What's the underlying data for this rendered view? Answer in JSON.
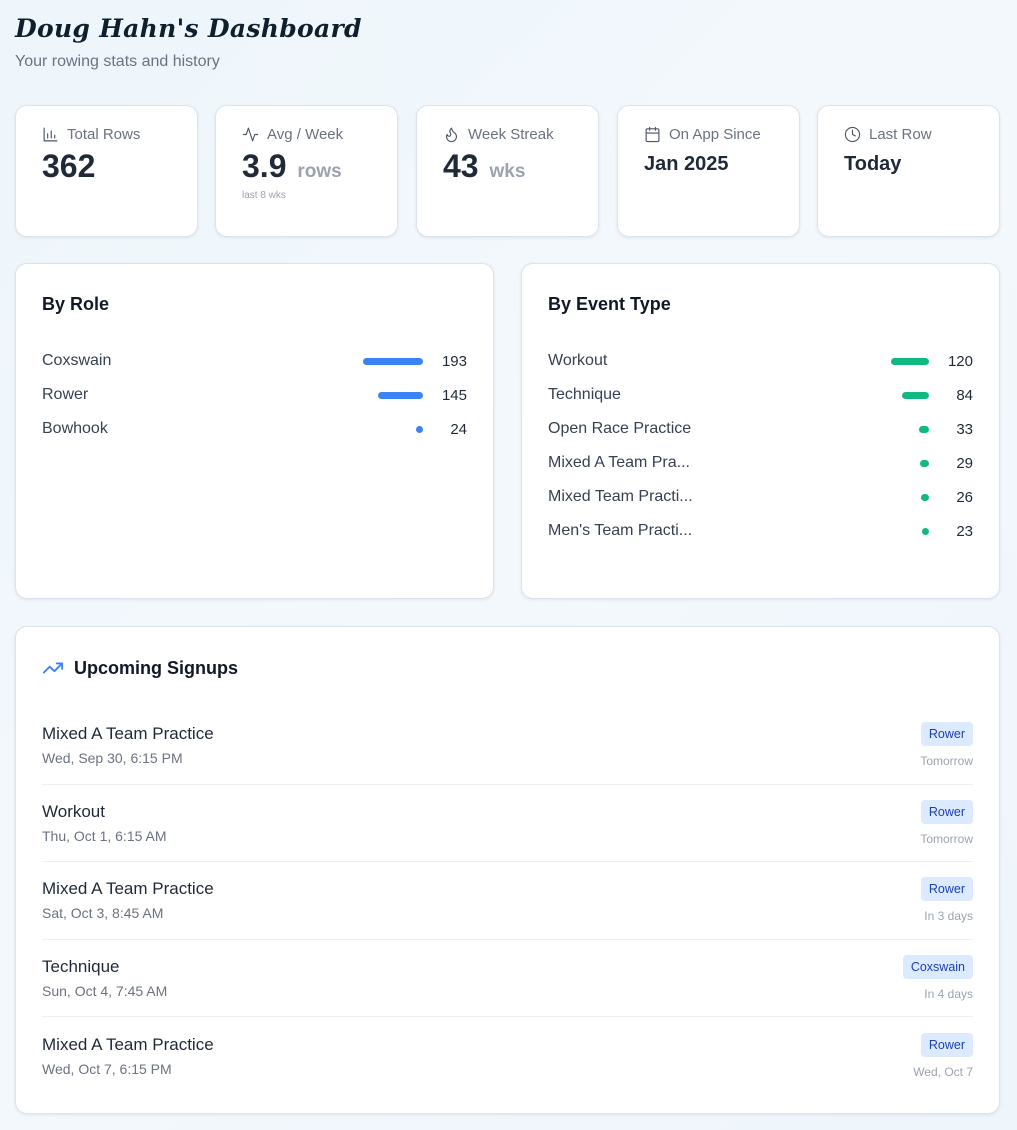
{
  "header": {
    "title": "Doug Hahn's Dashboard",
    "subtitle": "Your rowing stats and history"
  },
  "stats": [
    {
      "label": "Total Rows",
      "value": "362",
      "unit": "",
      "note": "",
      "icon": "bar-chart-icon"
    },
    {
      "label": "Avg / Week",
      "value": "3.9",
      "unit": "rows",
      "note": "last 8 wks",
      "icon": "activity-icon"
    },
    {
      "label": "Week Streak",
      "value": "43",
      "unit": "wks",
      "note": "",
      "icon": "flame-icon"
    },
    {
      "label": "On App Since",
      "value": "Jan 2025",
      "unit": "",
      "note": "",
      "icon": "calendar-icon"
    },
    {
      "label": "Last Row",
      "value": "Today",
      "unit": "",
      "note": "",
      "icon": "clock-icon"
    }
  ],
  "by_role": {
    "title": "By Role",
    "color": "#3b82f6",
    "items": [
      {
        "label": "Coxswain",
        "count": 193
      },
      {
        "label": "Rower",
        "count": 145
      },
      {
        "label": "Bowhook",
        "count": 24
      }
    ]
  },
  "by_event_type": {
    "title": "By Event Type",
    "color": "#10b981",
    "items": [
      {
        "label": "Workout",
        "count": 120
      },
      {
        "label": "Technique",
        "count": 84
      },
      {
        "label": "Open Race Practice",
        "count": 33
      },
      {
        "label": "Mixed A Team Pra...",
        "count": 29
      },
      {
        "label": "Mixed Team Practi...",
        "count": 26
      },
      {
        "label": "Men's Team Practi...",
        "count": 23
      }
    ]
  },
  "upcoming": {
    "title": "Upcoming Signups",
    "icon": "trending-up-icon",
    "items": [
      {
        "name": "Mixed A Team Practice",
        "time": "Wed, Sep 30, 6:15 PM",
        "role": "Rower",
        "when": "Tomorrow"
      },
      {
        "name": "Workout",
        "time": "Thu, Oct 1, 6:15 AM",
        "role": "Rower",
        "when": "Tomorrow"
      },
      {
        "name": "Mixed A Team Practice",
        "time": "Sat, Oct 3, 8:45 AM",
        "role": "Rower",
        "when": "In 3 days"
      },
      {
        "name": "Technique",
        "time": "Sun, Oct 4, 7:45 AM",
        "role": "Coxswain",
        "when": "In 4 days"
      },
      {
        "name": "Mixed A Team Practice",
        "time": "Wed, Oct 7, 6:15 PM",
        "role": "Rower",
        "when": "Wed, Oct 7"
      }
    ]
  }
}
